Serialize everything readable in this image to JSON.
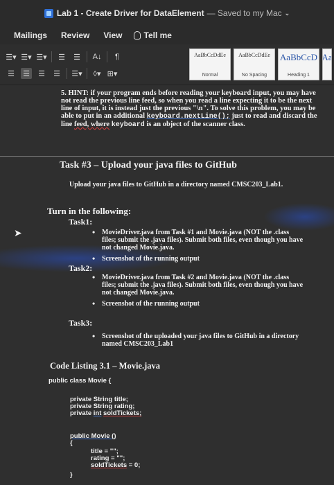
{
  "window": {
    "title": "Lab 1 - Create Driver for DataElement",
    "save_status": "— Saved to my Mac",
    "chevron": "⌄"
  },
  "menus": [
    "Mailings",
    "Review",
    "View"
  ],
  "tell_me": "Tell me",
  "ribbon": {
    "row1": [
      "☰▾",
      "☰▾",
      "☰▾",
      "☰",
      "☰",
      "A↓",
      "¶"
    ],
    "row2": [
      "☰",
      "☰",
      "☰",
      "☰",
      "☰▾",
      "◊▾",
      "⊞▾"
    ],
    "styles": [
      {
        "sample": "AaBbCcDdEe",
        "name": "Normal"
      },
      {
        "sample": "AaBbCcDdEe",
        "name": "No Spacing"
      },
      {
        "sample": "AaBbCcD",
        "name": "Heading 1"
      },
      {
        "sample": "Aa",
        "name": ""
      }
    ]
  },
  "document": {
    "hint_prefix": "5.  HINT: if your program ends before reading your keyboard input, you may have not read the previous line feed, so when you read a line expecting it to be the next line of input, it is instead just the previous \"\\n\". To solve this problem, you may be able to put in an additional ",
    "hint_code1": "keyboard.nextLine();",
    "hint_mid": " just to read and discard the line ",
    "hint_feed": "feed, where",
    "hint_code2": "keyboard",
    "hint_end": " is an object of the scanner class.",
    "task3_heading": "Task #3 – Upload your java files to GitHub",
    "upload_text": "Upload your java files to GitHub in a directory named CMSC203_Lab1.",
    "turn_in": "Turn in the following:",
    "task1": "Task1:",
    "task1_items": [
      "MovieDriver.java from Task #1 and Movie.java (NOT the .class files; submit the .java files). Submit both files, even though you have not changed Movie.java.",
      "Screenshot of the running output"
    ],
    "task2": "Task2:",
    "task2_items": [
      "MovieDriver.java from Task #2 and Movie.java (NOT the .class files; submit the .java files). Submit both files, even though you have not changed Movie.java.",
      "Screenshot of the running output"
    ],
    "task3": "Task3:",
    "task3_items": [
      "Screenshot of the uploaded your java files to GitHub in a directory named CMSC203_Lab1"
    ],
    "code_title": "Code Listing 3.1 – Movie.java",
    "code": {
      "class_decl": "public class Movie {",
      "f1": "private String title;",
      "f2": "private String rating;",
      "f3_prefix": "private ",
      "f3_type": "int",
      "f3_name": "soldTickets;",
      "ctor": "public Movie ()",
      "open": "{",
      "a1": "title = \"\";",
      "a2": "rating = \"\";",
      "a3_name": "soldTickets",
      "a3_rest": " = 0;",
      "close": "}"
    }
  }
}
